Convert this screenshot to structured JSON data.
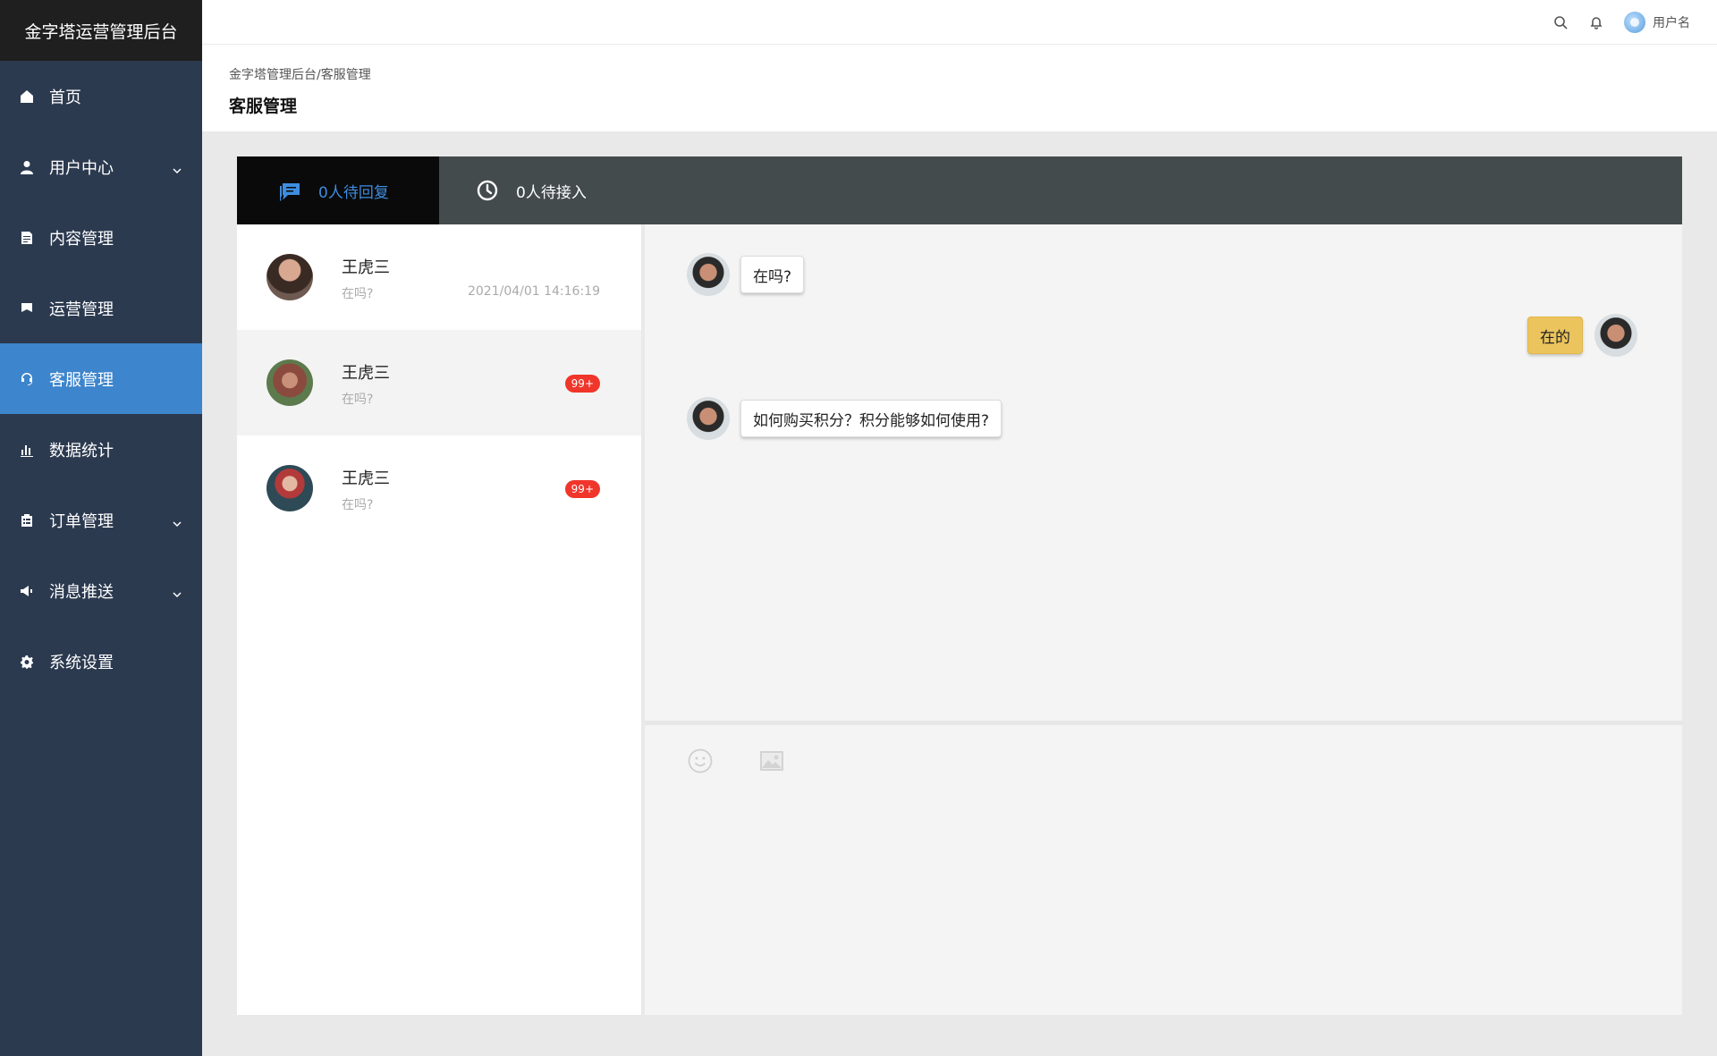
{
  "sidebar": {
    "brand": "金字塔运营管理后台",
    "items": [
      {
        "label": "首页",
        "icon": "home-icon"
      },
      {
        "label": "用户中心",
        "icon": "user-icon",
        "expandable": true
      },
      {
        "label": "内容管理",
        "icon": "document-icon"
      },
      {
        "label": "运营管理",
        "icon": "flag-icon"
      },
      {
        "label": "客服管理",
        "icon": "headset-icon",
        "active": true
      },
      {
        "label": "数据统计",
        "icon": "bar-chart-icon"
      },
      {
        "label": "订单管理",
        "icon": "clipboard-icon",
        "expandable": true
      },
      {
        "label": "消息推送",
        "icon": "megaphone-icon",
        "expandable": true
      },
      {
        "label": "系统设置",
        "icon": "gear-icon"
      }
    ]
  },
  "header": {
    "username": "用户名"
  },
  "page": {
    "breadcrumb": "金字塔管理后台/客服管理",
    "title": "客服管理"
  },
  "tabs": [
    {
      "label": "0人待回复",
      "icon": "chat-icon",
      "active": true
    },
    {
      "label": "0人待接入",
      "icon": "clock-icon"
    }
  ],
  "conversations": [
    {
      "name": "王虎三",
      "preview": "在吗?",
      "time": "2021/04/01  14:16:19",
      "badge": ""
    },
    {
      "name": "王虎三",
      "preview": "在吗?",
      "time": "",
      "badge": "99+"
    },
    {
      "name": "王虎三",
      "preview": "在吗?",
      "time": "",
      "badge": "99+"
    }
  ],
  "messages": [
    {
      "text": "在吗?",
      "mine": false
    },
    {
      "text": "在的",
      "mine": true
    },
    {
      "text": "如何购买积分？积分能够如何使用?",
      "mine": false
    }
  ],
  "colors": {
    "sidebar_bg": "#2c3a50",
    "active": "#3d85cc",
    "tab_active_text": "#3d8de0",
    "badge": "#f0352b",
    "my_bubble": "#ecc45d"
  }
}
